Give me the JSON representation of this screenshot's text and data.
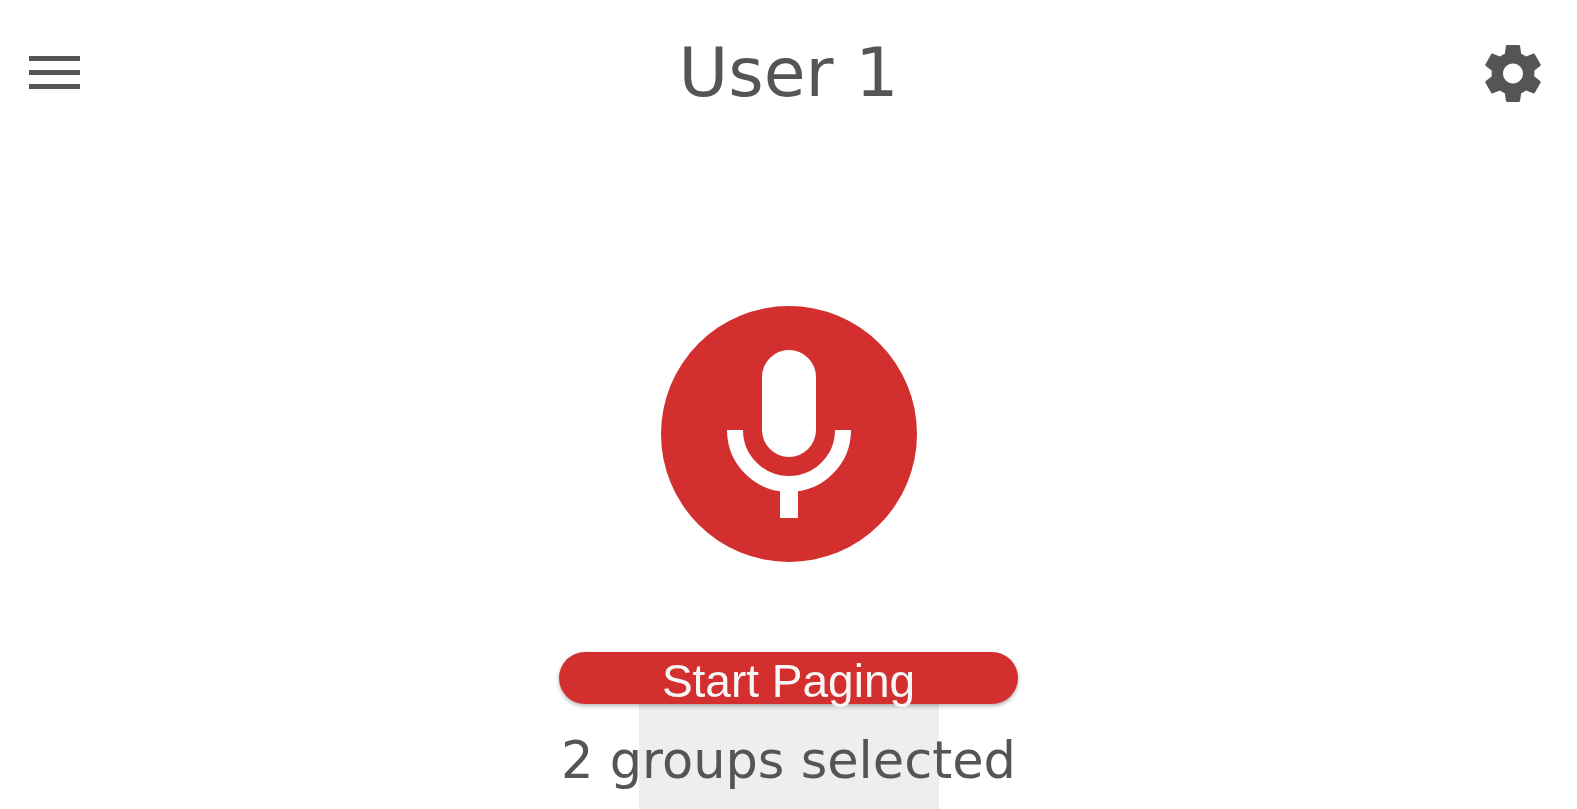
{
  "header": {
    "title": "User 1"
  },
  "page_button": {
    "label": "Start Paging"
  },
  "selection_summary": "2 groups selected"
}
